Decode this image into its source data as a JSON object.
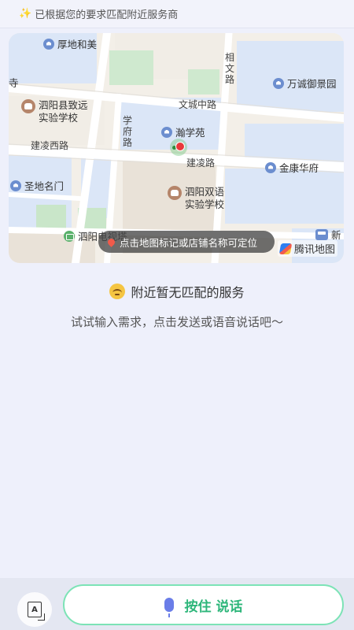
{
  "topbar": {
    "sparkle_icon": "sparkle-icon",
    "text": "已根据您的要求匹配附近服务商"
  },
  "map": {
    "labels": {
      "houdi_hemei": "厚地和美",
      "baijing_si": "寺",
      "xiangwen_lu": "相文路",
      "wancheng_yujingyuan": "万诚御景园",
      "siyang_zhiyuan_school_l1": "泗阳县致远",
      "siyang_zhiyuan_school_l2": "实验学校",
      "wencheng_zhonglu": "文城中路",
      "xuefu_lu": "学府路",
      "hanxueyuan": "瀚学苑",
      "jianling_xilu": "建凌西路",
      "jianling_lu": "建凌路",
      "jinkang_huafu": "金康华府",
      "shengdi_mingmen": "圣地名门",
      "siyang_shuangyu_l1": "泗阳双语",
      "siyang_shuangyu_l2": "实验学校",
      "siyang_tv_tower": "泗阳电视塔",
      "xin": "新"
    },
    "tip": "点击地图标记或店铺名称可定位",
    "brand": "腾讯地图",
    "brand_icon": "tencent-map-logo-icon",
    "location_icon": "current-location-icon"
  },
  "empty": {
    "emoji_icon": "sad-face-icon",
    "title": "附近暂无匹配的服务",
    "subtitle": "试试输入需求，点击发送或语音说话吧～"
  },
  "bottom": {
    "keyboard_icon": "keyboard-input-icon",
    "keyboard_glyph": "A",
    "talk_label": "按住 说话",
    "mic_icon": "microphone-icon"
  }
}
